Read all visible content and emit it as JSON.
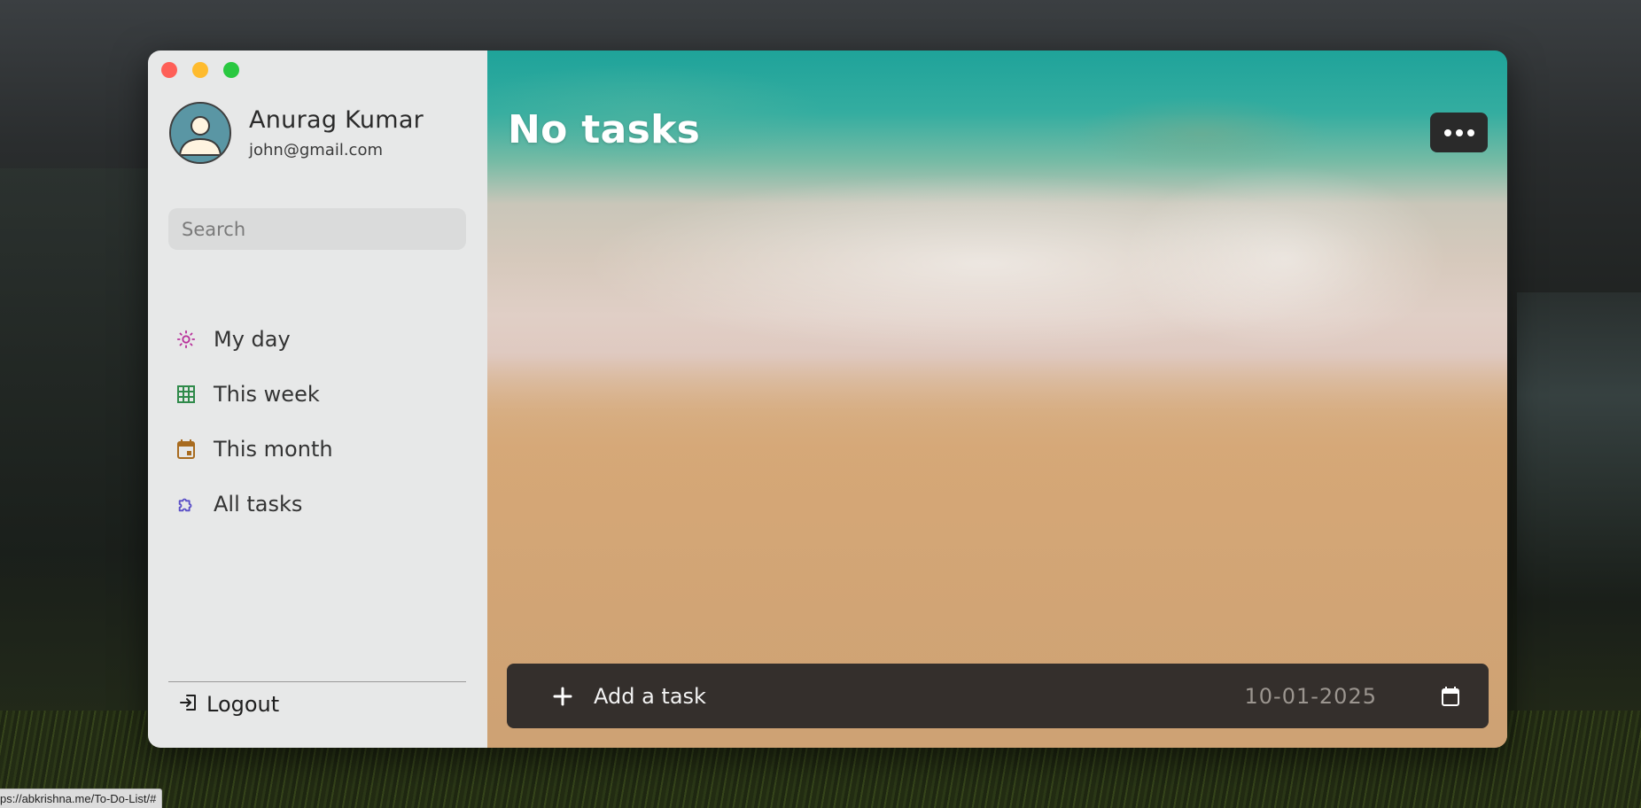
{
  "user": {
    "name": "Anurag Kumar",
    "email": "john@gmail.com"
  },
  "search": {
    "placeholder": "Search"
  },
  "nav": {
    "items": [
      {
        "label": "My day",
        "icon": "sun-icon",
        "color": "#b8309a"
      },
      {
        "label": "This week",
        "icon": "grid-calendar-icon",
        "color": "#2f8a4a"
      },
      {
        "label": "This month",
        "icon": "calendar-icon",
        "color": "#a86b1f"
      },
      {
        "label": "All tasks",
        "icon": "puzzle-icon",
        "color": "#5a4fc7"
      }
    ]
  },
  "logout": {
    "label": "Logout",
    "icon": "logout-icon"
  },
  "main": {
    "title": "No tasks",
    "menu_icon": "more-dots-icon"
  },
  "add_task": {
    "placeholder": "Add a task",
    "date": "10-01-2025",
    "plus_icon": "plus-icon",
    "calendar_icon": "calendar-icon"
  },
  "status_bar": {
    "url": "ps://abkrishna.me/To-Do-List/#"
  }
}
